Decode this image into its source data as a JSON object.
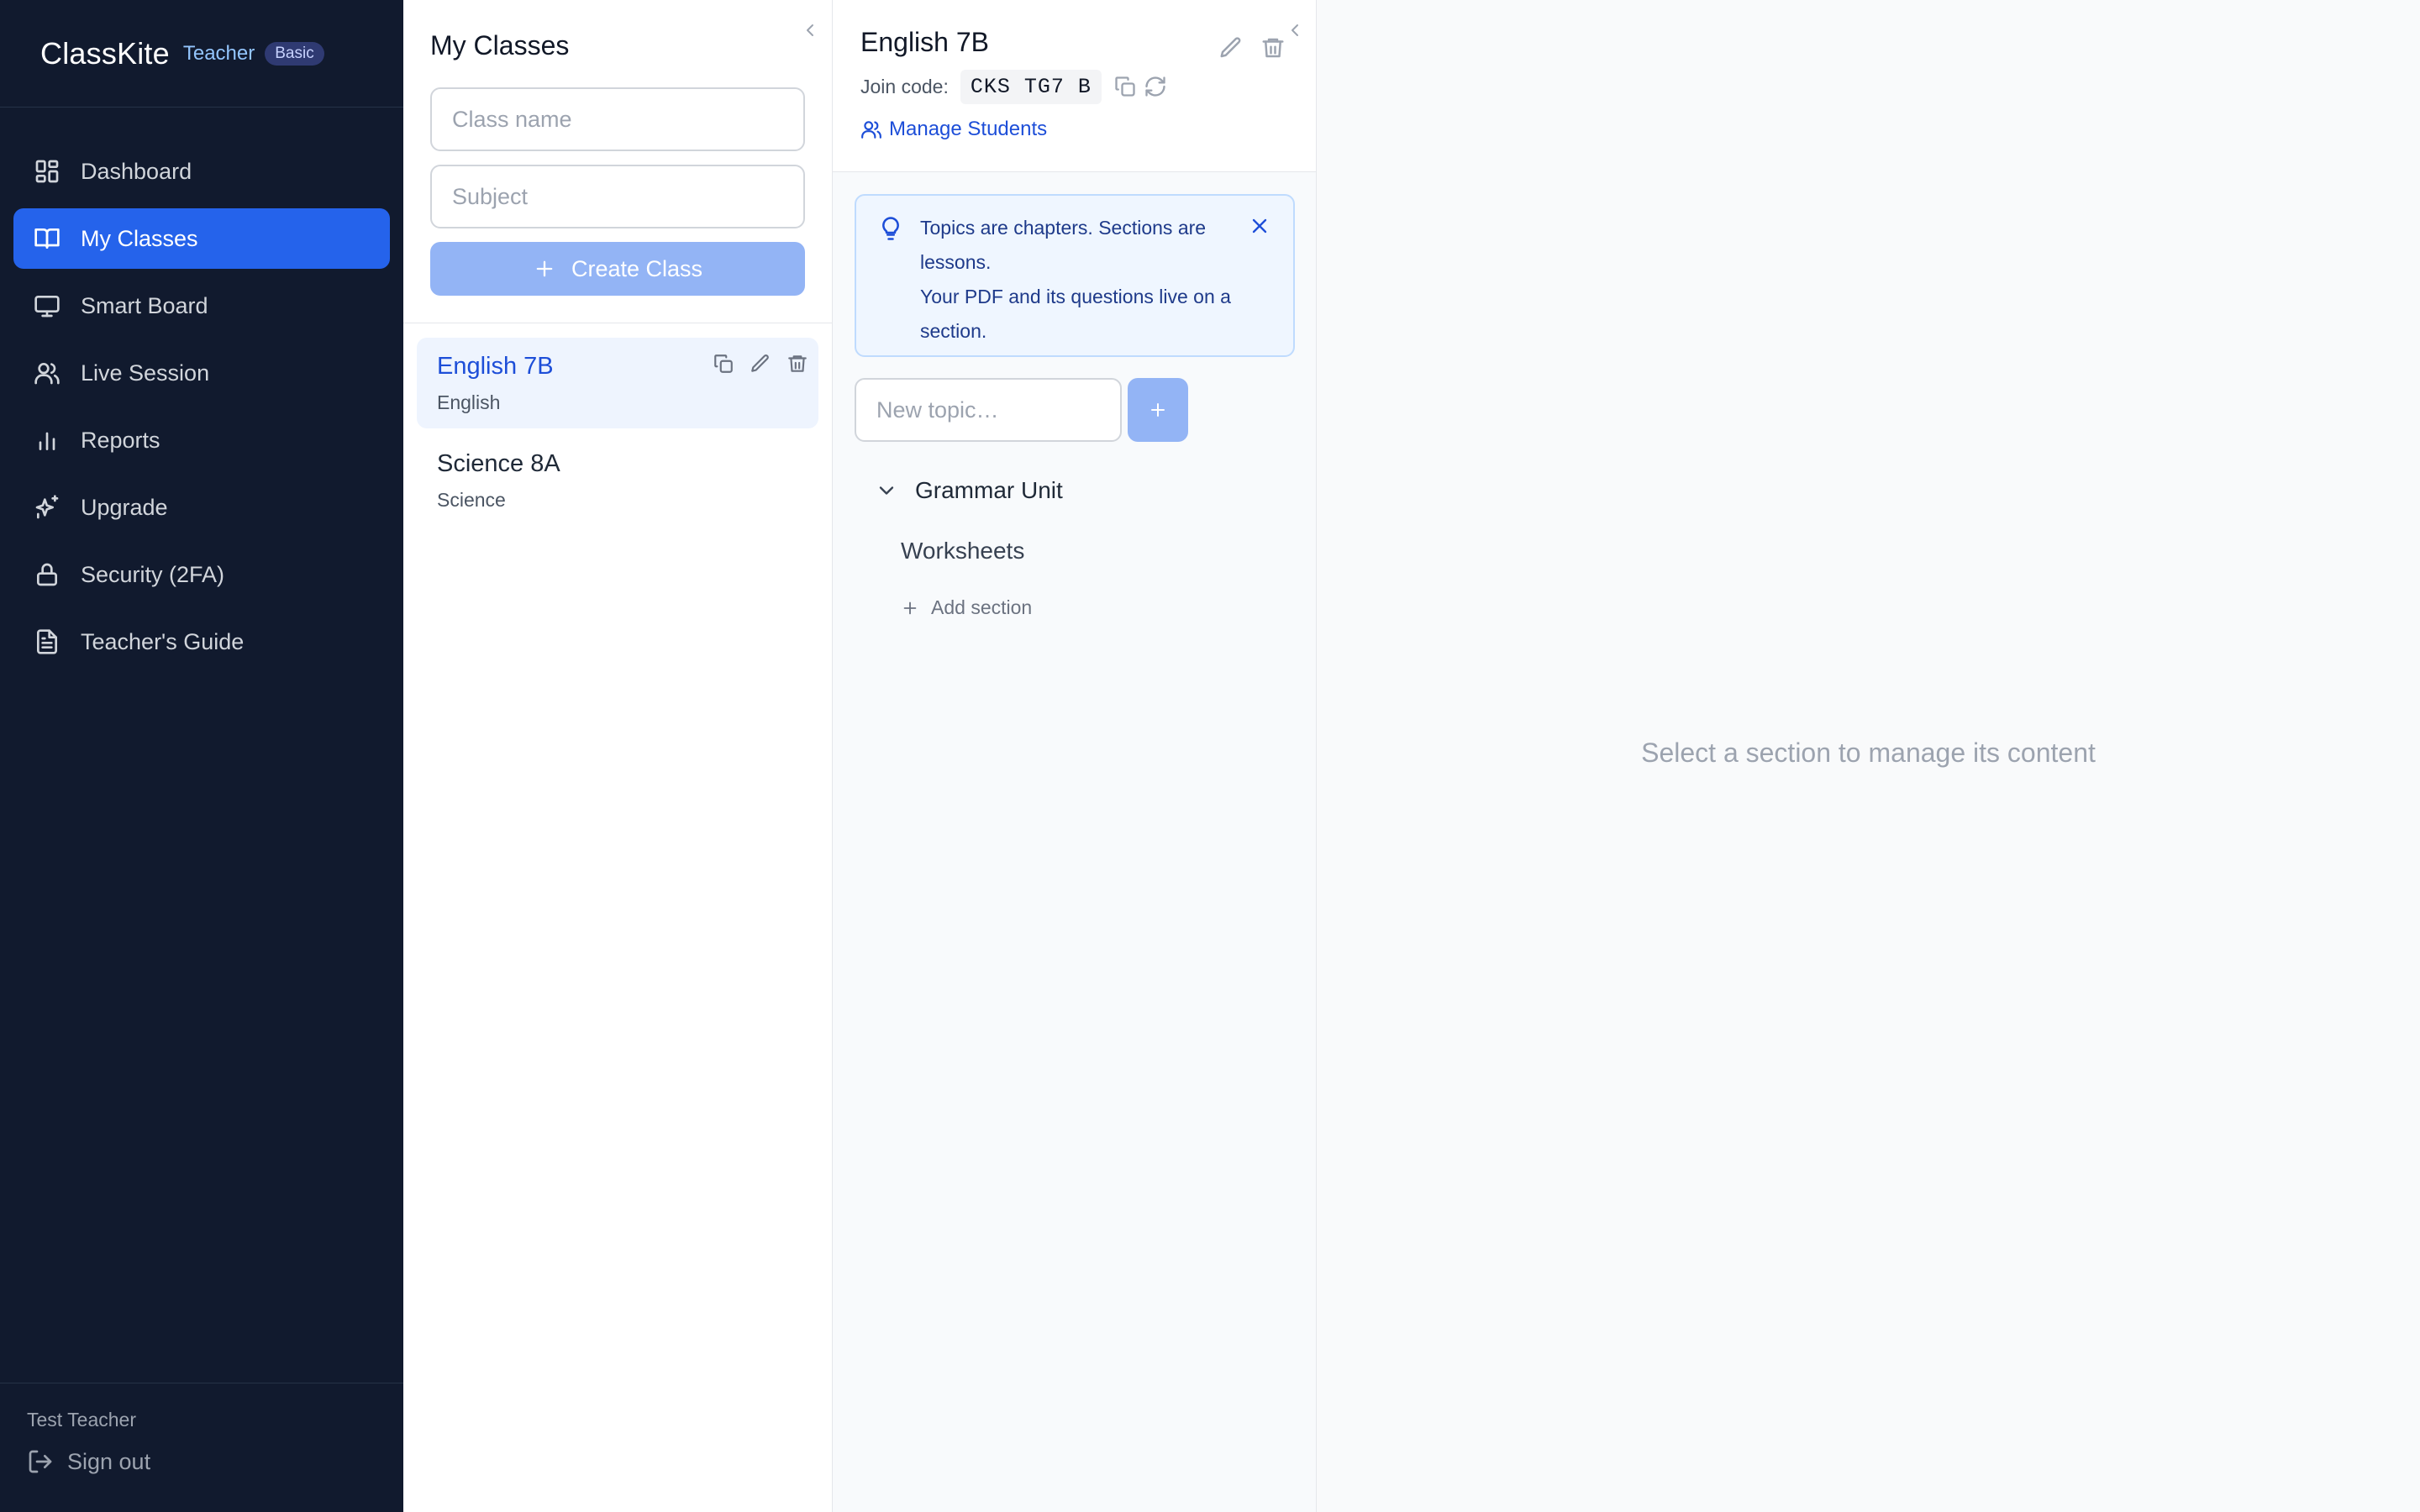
{
  "app": {
    "brand": "ClassKite",
    "role": "Teacher",
    "plan": "Basic"
  },
  "sidebar": {
    "items": [
      {
        "label": "Dashboard",
        "icon": "dashboard-icon",
        "active": false
      },
      {
        "label": "My Classes",
        "icon": "book-open-icon",
        "active": true
      },
      {
        "label": "Smart Board",
        "icon": "monitor-icon",
        "active": false
      },
      {
        "label": "Live Session",
        "icon": "users-icon",
        "active": false
      },
      {
        "label": "Reports",
        "icon": "bar-chart-icon",
        "active": false
      },
      {
        "label": "Upgrade",
        "icon": "sparkles-icon",
        "active": false
      },
      {
        "label": "Security (2FA)",
        "icon": "lock-icon",
        "active": false
      },
      {
        "label": "Teacher's Guide",
        "icon": "document-icon",
        "active": false
      }
    ],
    "user_name": "Test Teacher",
    "sign_out": "Sign out"
  },
  "classes_panel": {
    "title": "My Classes",
    "class_name_placeholder": "Class name",
    "subject_placeholder": "Subject",
    "create_label": "Create Class",
    "classes": [
      {
        "name": "English 7B",
        "subject": "English",
        "selected": true
      },
      {
        "name": "Science 8A",
        "subject": "Science",
        "selected": false
      }
    ]
  },
  "class_detail": {
    "title": "English 7B",
    "join_label": "Join code:",
    "join_code": "CKS TG7 B",
    "manage_students": "Manage Students",
    "tip_line1": "Topics are chapters. Sections are lessons.",
    "tip_line2": "Your PDF and its questions live on a section.",
    "new_topic_placeholder": "New topic…",
    "topics": [
      {
        "name": "Grammar Unit",
        "expanded": true,
        "sections": [
          "Worksheets"
        ]
      }
    ],
    "add_section": "Add section"
  },
  "content": {
    "empty_message": "Select a section to manage its content"
  },
  "colors": {
    "sidebar_bg": "#111a2e",
    "accent": "#2563eb",
    "accent_disabled": "#93b4f5",
    "tip_bg": "#eff6ff",
    "link": "#1d4ed8"
  }
}
